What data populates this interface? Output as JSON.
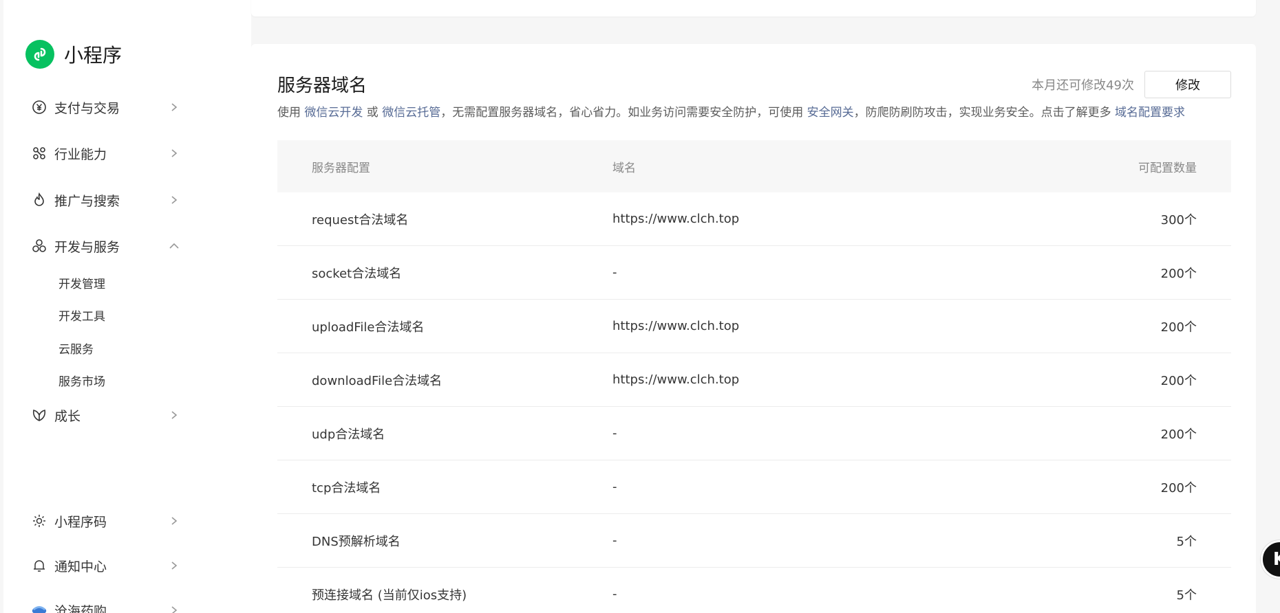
{
  "app": {
    "name": "小程序",
    "brand_color": "#07c160",
    "link_color": "#576b95"
  },
  "sidebar": {
    "items": [
      {
        "label": "支付与交易",
        "icon": "yen-circle-icon"
      },
      {
        "label": "行业能力",
        "icon": "industry-nodes-icon"
      },
      {
        "label": "推广与搜索",
        "icon": "flame-icon"
      },
      {
        "label": "开发与服务",
        "icon": "cubes-icon",
        "expanded": true
      },
      {
        "label": "成长",
        "icon": "leaf-icon"
      }
    ],
    "subitems": [
      "开发管理",
      "开发工具",
      "云服务",
      "服务市场"
    ],
    "bottom": [
      {
        "label": "小程序码",
        "icon": "qrcode-sun-icon"
      },
      {
        "label": "通知中心",
        "icon": "bell-icon"
      },
      {
        "label": "沧海药购",
        "icon": "account-avatar-icon"
      }
    ]
  },
  "server_domain": {
    "title": "服务器域名",
    "quota_text": "本月还可修改49次",
    "edit_label": "修改",
    "desc": {
      "prefix": "使用 ",
      "link1": "微信云开发",
      "or": " 或 ",
      "link2": "微信云托管",
      "mid": "，无需配置服务器域名，省心省力。如业务访问需要安全防护，可使用 ",
      "link3": "安全网关",
      "mid2": "，防爬防刷防攻击，实现业务安全。点击了解更多 ",
      "link4": "域名配置要求"
    },
    "table": {
      "headers": [
        "服务器配置",
        "域名",
        "可配置数量"
      ],
      "rows": [
        {
          "config": "request合法域名",
          "domain": "https://www.clch.top",
          "count": "300个"
        },
        {
          "config": "socket合法域名",
          "domain": "-",
          "count": "200个"
        },
        {
          "config": "uploadFile合法域名",
          "domain": "https://www.clch.top",
          "count": "200个"
        },
        {
          "config": "downloadFile合法域名",
          "domain": "https://www.clch.top",
          "count": "200个"
        },
        {
          "config": "udp合法域名",
          "domain": "-",
          "count": "200个"
        },
        {
          "config": "tcp合法域名",
          "domain": "-",
          "count": "200个"
        },
        {
          "config": "DNS预解析域名",
          "domain": "-",
          "count": "5个"
        },
        {
          "config": "预连接域名 (当前仅ios支持)",
          "domain": "-",
          "count": "5个"
        }
      ]
    }
  },
  "floating_button": {
    "label": "K"
  }
}
